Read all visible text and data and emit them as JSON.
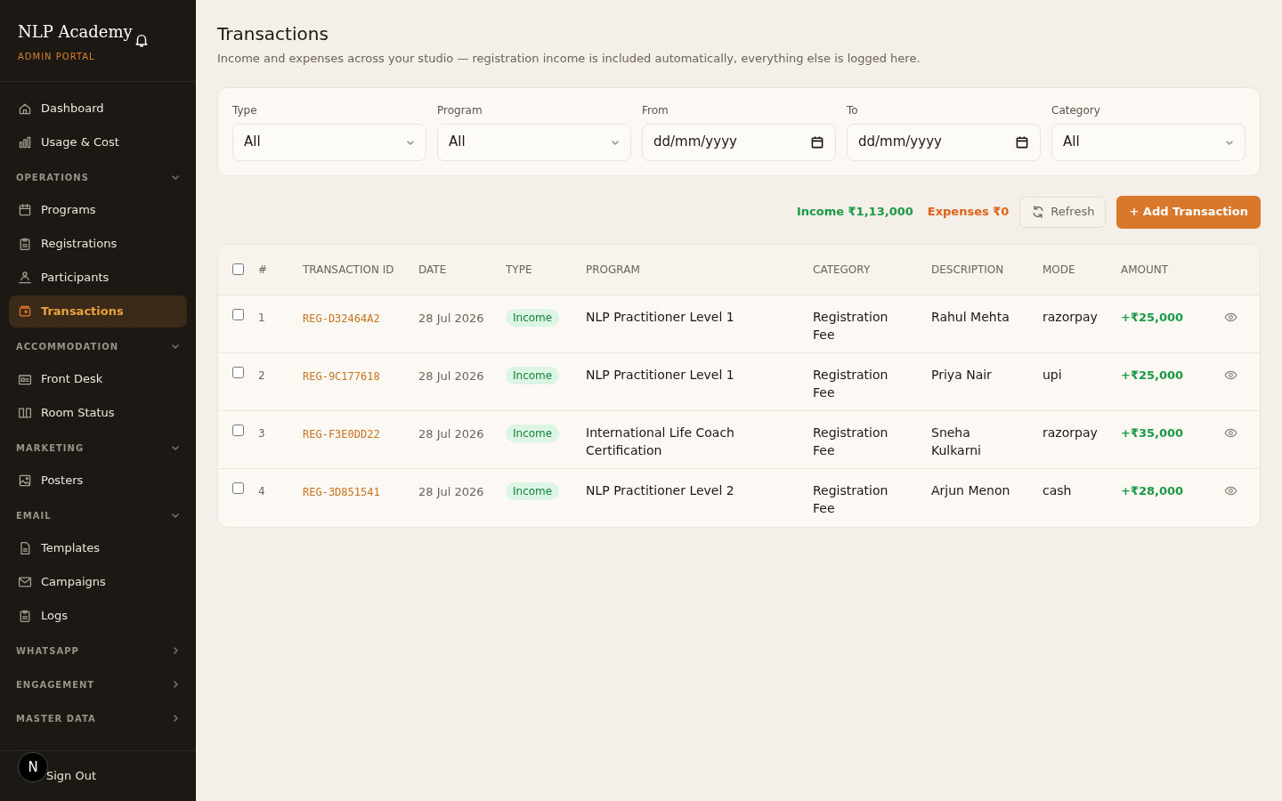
{
  "sidebar": {
    "brand": "NLP Academy",
    "subtitle": "ADMIN PORTAL",
    "top_items": [
      {
        "label": "Dashboard",
        "kind": "home",
        "selected": false
      },
      {
        "label": "Usage & Cost",
        "kind": "chart",
        "selected": false
      }
    ],
    "groups": [
      {
        "label": "OPERATIONS",
        "expanded": true,
        "items": [
          {
            "label": "Programs",
            "kind": "calendar",
            "selected": false
          },
          {
            "label": "Registrations",
            "kind": "clipboard",
            "selected": false
          },
          {
            "label": "Participants",
            "kind": "people",
            "selected": false
          },
          {
            "label": "Transactions",
            "kind": "wallet",
            "selected": true
          }
        ]
      },
      {
        "label": "ACCOMMODATION",
        "expanded": true,
        "items": [
          {
            "label": "Front Desk",
            "kind": "desk",
            "selected": false
          },
          {
            "label": "Room Status",
            "kind": "book",
            "selected": false
          }
        ]
      },
      {
        "label": "MARKETING",
        "expanded": true,
        "items": [
          {
            "label": "Posters",
            "kind": "image",
            "selected": false
          }
        ]
      },
      {
        "label": "EMAIL",
        "expanded": true,
        "items": [
          {
            "label": "Templates",
            "kind": "file",
            "selected": false
          },
          {
            "label": "Campaigns",
            "kind": "mail",
            "selected": false
          },
          {
            "label": "Logs",
            "kind": "clipboard",
            "selected": false
          }
        ]
      },
      {
        "label": "WHATSAPP",
        "expanded": false
      },
      {
        "label": "ENGAGEMENT",
        "expanded": false
      },
      {
        "label": "MASTER DATA",
        "expanded": false
      }
    ],
    "sign_out": "Sign Out",
    "dev_badge": "N"
  },
  "page": {
    "title": "Transactions",
    "subtitle": "Income and expenses across your studio — registration income is included automatically, everything else is logged here."
  },
  "filters": [
    {
      "label": "Type",
      "kind": "select",
      "value": "All"
    },
    {
      "label": "Program",
      "kind": "select",
      "value": "All"
    },
    {
      "label": "From",
      "kind": "date",
      "value": "dd/mm/yyyy"
    },
    {
      "label": "To",
      "kind": "date",
      "value": "dd/mm/yyyy"
    },
    {
      "label": "Category",
      "kind": "select",
      "value": "All"
    }
  ],
  "summary": {
    "income": "Income ₹1,13,000",
    "expenses": "Expenses ₹0",
    "refresh": "Refresh",
    "add": "+ Add Transaction"
  },
  "table": {
    "select_all_checked": false,
    "columns": [
      "#",
      "TRANSACTION ID",
      "DATE",
      "TYPE",
      "PROGRAM",
      "CATEGORY",
      "DESCRIPTION",
      "MODE",
      "AMOUNT"
    ],
    "rows": [
      {
        "checked": false,
        "num": "1",
        "id": "REG-D32464A2",
        "date": "28 Jul 2026",
        "type": "Income",
        "program": "NLP Practitioner Level 1",
        "category": "Registration Fee",
        "description": "Rahul Mehta",
        "mode": "razorpay",
        "amount": "+₹25,000"
      },
      {
        "checked": false,
        "num": "2",
        "id": "REG-9C177618",
        "date": "28 Jul 2026",
        "type": "Income",
        "program": "NLP Practitioner Level 1",
        "category": "Registration Fee",
        "description": "Priya Nair",
        "mode": "upi",
        "amount": "+₹25,000"
      },
      {
        "checked": false,
        "num": "3",
        "id": "REG-F3E0DD22",
        "date": "28 Jul 2026",
        "type": "Income",
        "program": "International Life Coach Certification",
        "category": "Registration Fee",
        "description": "Sneha Kulkarni",
        "mode": "razorpay",
        "amount": "+₹35,000"
      },
      {
        "checked": false,
        "num": "4",
        "id": "REG-3D851541",
        "date": "28 Jul 2026",
        "type": "Income",
        "program": "NLP Practitioner Level 2",
        "category": "Registration Fee",
        "description": "Arjun Menon",
        "mode": "cash",
        "amount": "+₹28,000"
      }
    ]
  }
}
